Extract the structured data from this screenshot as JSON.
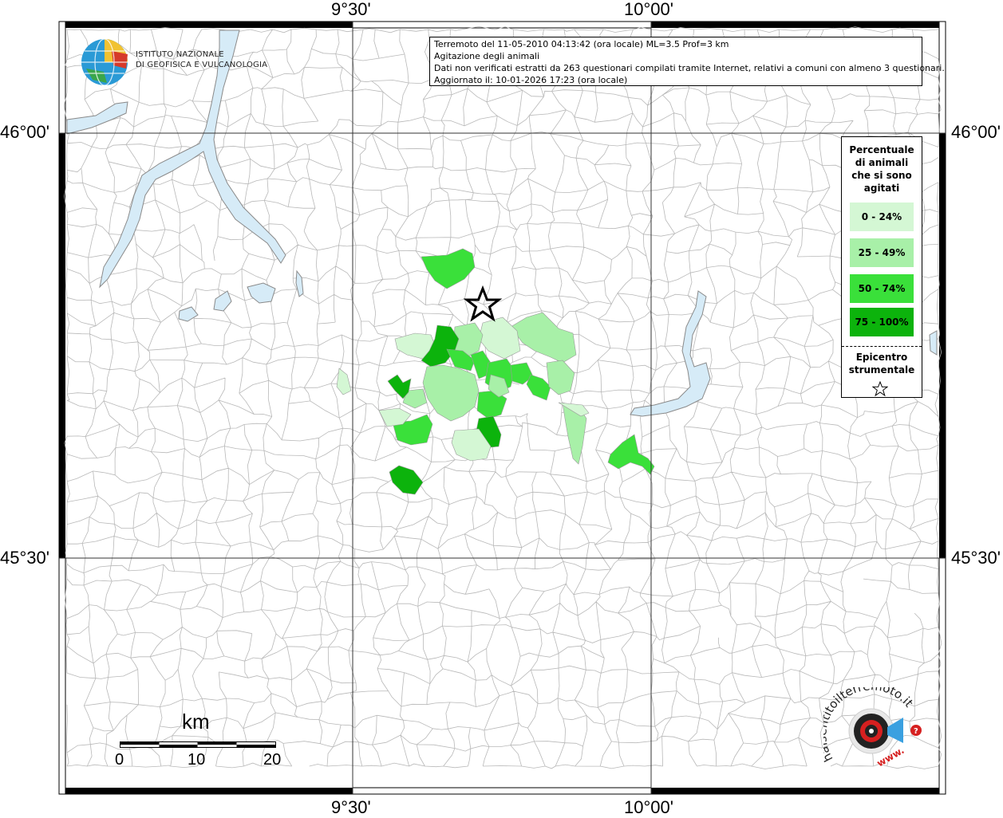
{
  "map": {
    "lon_ticks": [
      "9°30'",
      "10°00'"
    ],
    "lat_ticks": [
      "46°00'",
      "45°30'"
    ],
    "background_color": "#ffffff",
    "water_color": "#d6ebf7",
    "grid_color": "#333333",
    "border_color": "#b3b3b3"
  },
  "info": {
    "line1": "Terremoto del 11-05-2010 04:13:42 (ora locale) ML=3.5 Prof=3 km",
    "line2": "Agitazione degli animali",
    "line3": "Dati non verificati estratti da 263 questionari compilati tramite Internet, relativi a comuni con almeno 3 questionari.",
    "line4": "Aggiornato il: 10-01-2026 17:23 (ora locale)"
  },
  "legend": {
    "title": "Percentuale di animali che si sono agitati",
    "classes": [
      {
        "label": "0 - 24%",
        "color": "#d4f7d4"
      },
      {
        "label": "25 - 49%",
        "color": "#a8f0a8"
      },
      {
        "label": "50 - 74%",
        "color": "#3ae03a"
      },
      {
        "label": "75 - 100%",
        "color": "#0cb30c"
      }
    ],
    "epicenter_label": "Epicentro strumentale",
    "epicenter_icon": "star-outline-icon"
  },
  "logos": {
    "ingv_name_line1": "ISTITUTO NAZIONALE",
    "ingv_name_line2": "DI GEOFISICA E VULCANOLOGIA",
    "hst_text": "haisentitoilterremoto.it",
    "hst_url": "www."
  },
  "scale": {
    "unit": "km",
    "labels": [
      "0",
      "10",
      "20"
    ]
  }
}
